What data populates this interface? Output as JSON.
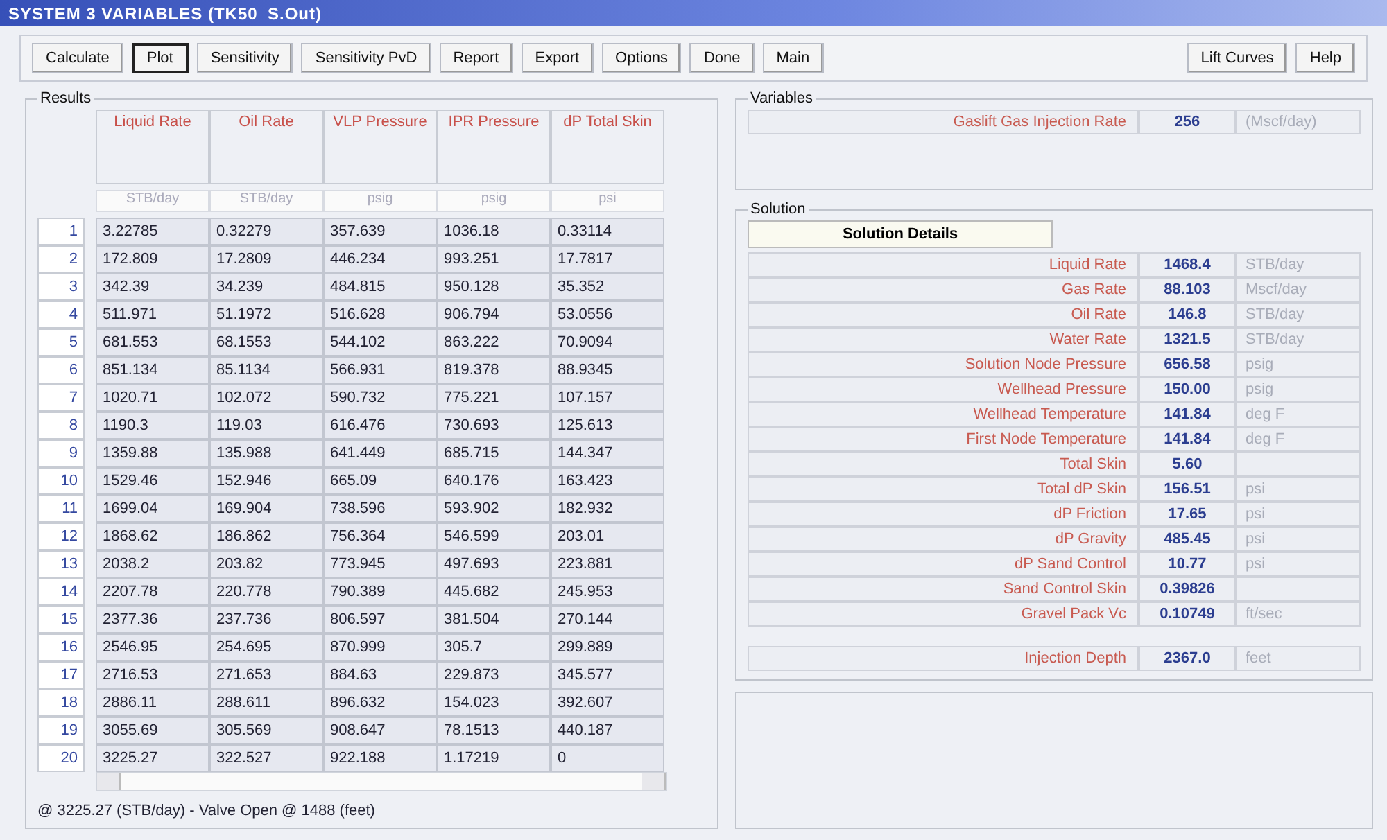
{
  "window": {
    "title": "SYSTEM 3 VARIABLES (TK50_S.Out)"
  },
  "toolbar": [
    {
      "label": "Calculate",
      "selected": false
    },
    {
      "label": "Plot",
      "selected": true
    },
    {
      "label": "Sensitivity",
      "selected": false
    },
    {
      "label": "Sensitivity PvD",
      "selected": false
    },
    {
      "label": "Report",
      "selected": false
    },
    {
      "label": "Export",
      "selected": false
    },
    {
      "label": "Options",
      "selected": false
    },
    {
      "label": "Done",
      "selected": false
    },
    {
      "label": "Main",
      "selected": false
    }
  ],
  "toolbar_right": [
    {
      "label": "Lift Curves",
      "selected": false
    },
    {
      "label": "Help",
      "selected": false
    }
  ],
  "results": {
    "title": "Results",
    "columns": [
      {
        "name": "Liquid Rate",
        "unit": "STB/day"
      },
      {
        "name": "Oil Rate",
        "unit": "STB/day"
      },
      {
        "name": "VLP Pressure",
        "unit": "psig"
      },
      {
        "name": "IPR Pressure",
        "unit": "psig"
      },
      {
        "name": "dP Total Skin",
        "unit": "psi"
      }
    ],
    "rows": [
      {
        "index": "1",
        "cells": [
          "3.22785",
          "0.32279",
          "357.639",
          "1036.18",
          "0.33114"
        ]
      },
      {
        "index": "2",
        "cells": [
          "172.809",
          "17.2809",
          "446.234",
          "993.251",
          "17.7817"
        ]
      },
      {
        "index": "3",
        "cells": [
          "342.39",
          "34.239",
          "484.815",
          "950.128",
          "35.352"
        ]
      },
      {
        "index": "4",
        "cells": [
          "511.971",
          "51.1972",
          "516.628",
          "906.794",
          "53.0556"
        ]
      },
      {
        "index": "5",
        "cells": [
          "681.553",
          "68.1553",
          "544.102",
          "863.222",
          "70.9094"
        ]
      },
      {
        "index": "6",
        "cells": [
          "851.134",
          "85.1134",
          "566.931",
          "819.378",
          "88.9345"
        ]
      },
      {
        "index": "7",
        "cells": [
          "1020.71",
          "102.072",
          "590.732",
          "775.221",
          "107.157"
        ]
      },
      {
        "index": "8",
        "cells": [
          "1190.3",
          "119.03",
          "616.476",
          "730.693",
          "125.613"
        ]
      },
      {
        "index": "9",
        "cells": [
          "1359.88",
          "135.988",
          "641.449",
          "685.715",
          "144.347"
        ]
      },
      {
        "index": "10",
        "cells": [
          "1529.46",
          "152.946",
          "665.09",
          "640.176",
          "163.423"
        ]
      },
      {
        "index": "11",
        "cells": [
          "1699.04",
          "169.904",
          "738.596",
          "593.902",
          "182.932"
        ]
      },
      {
        "index": "12",
        "cells": [
          "1868.62",
          "186.862",
          "756.364",
          "546.599",
          "203.01"
        ]
      },
      {
        "index": "13",
        "cells": [
          "2038.2",
          "203.82",
          "773.945",
          "497.693",
          "223.881"
        ]
      },
      {
        "index": "14",
        "cells": [
          "2207.78",
          "220.778",
          "790.389",
          "445.682",
          "245.953"
        ]
      },
      {
        "index": "15",
        "cells": [
          "2377.36",
          "237.736",
          "806.597",
          "381.504",
          "270.144"
        ]
      },
      {
        "index": "16",
        "cells": [
          "2546.95",
          "254.695",
          "870.999",
          "305.7",
          "299.889"
        ]
      },
      {
        "index": "17",
        "cells": [
          "2716.53",
          "271.653",
          "884.63",
          "229.873",
          "345.577"
        ]
      },
      {
        "index": "18",
        "cells": [
          "2886.11",
          "288.611",
          "896.632",
          "154.023",
          "392.607"
        ]
      },
      {
        "index": "19",
        "cells": [
          "3055.69",
          "305.569",
          "908.647",
          "78.1513",
          "440.187"
        ]
      },
      {
        "index": "20",
        "cells": [
          "3225.27",
          "322.527",
          "922.188",
          "1.17219",
          "0"
        ]
      }
    ],
    "status": "@ 3225.27 (STB/day) - Valve Open @ 1488 (feet)"
  },
  "variables": {
    "title": "Variables",
    "rows": [
      {
        "label": "Gaslift Gas Injection Rate",
        "value": "256",
        "unit": "(Mscf/day)"
      }
    ]
  },
  "solution": {
    "title": "Solution",
    "details_button": "Solution Details",
    "rows": [
      {
        "label": "Liquid Rate",
        "value": "1468.4",
        "unit": "STB/day"
      },
      {
        "label": "Gas Rate",
        "value": "88.103",
        "unit": "Mscf/day"
      },
      {
        "label": "Oil Rate",
        "value": "146.8",
        "unit": "STB/day"
      },
      {
        "label": "Water Rate",
        "value": "1321.5",
        "unit": "STB/day"
      },
      {
        "label": "Solution Node Pressure",
        "value": "656.58",
        "unit": "psig"
      },
      {
        "label": "Wellhead Pressure",
        "value": "150.00",
        "unit": "psig"
      },
      {
        "label": "Wellhead Temperature",
        "value": "141.84",
        "unit": "deg F"
      },
      {
        "label": "First Node Temperature",
        "value": "141.84",
        "unit": "deg F"
      },
      {
        "label": "Total Skin",
        "value": "5.60"
      },
      {
        "label": "Total dP Skin",
        "value": "156.51",
        "unit": "psi"
      },
      {
        "label": "dP Friction",
        "value": "17.65",
        "unit": "psi"
      },
      {
        "label": "dP Gravity",
        "value": "485.45",
        "unit": "psi"
      },
      {
        "label": "dP Sand Control",
        "value": "10.77",
        "unit": "psi"
      },
      {
        "label": "Sand Control Skin",
        "value": "0.39826"
      },
      {
        "label": "Gravel Pack Vc",
        "value": "0.10749",
        "unit": "ft/sec"
      }
    ],
    "injection": {
      "label": "Injection Depth",
      "value": "2367.0",
      "unit": "feet"
    }
  }
}
